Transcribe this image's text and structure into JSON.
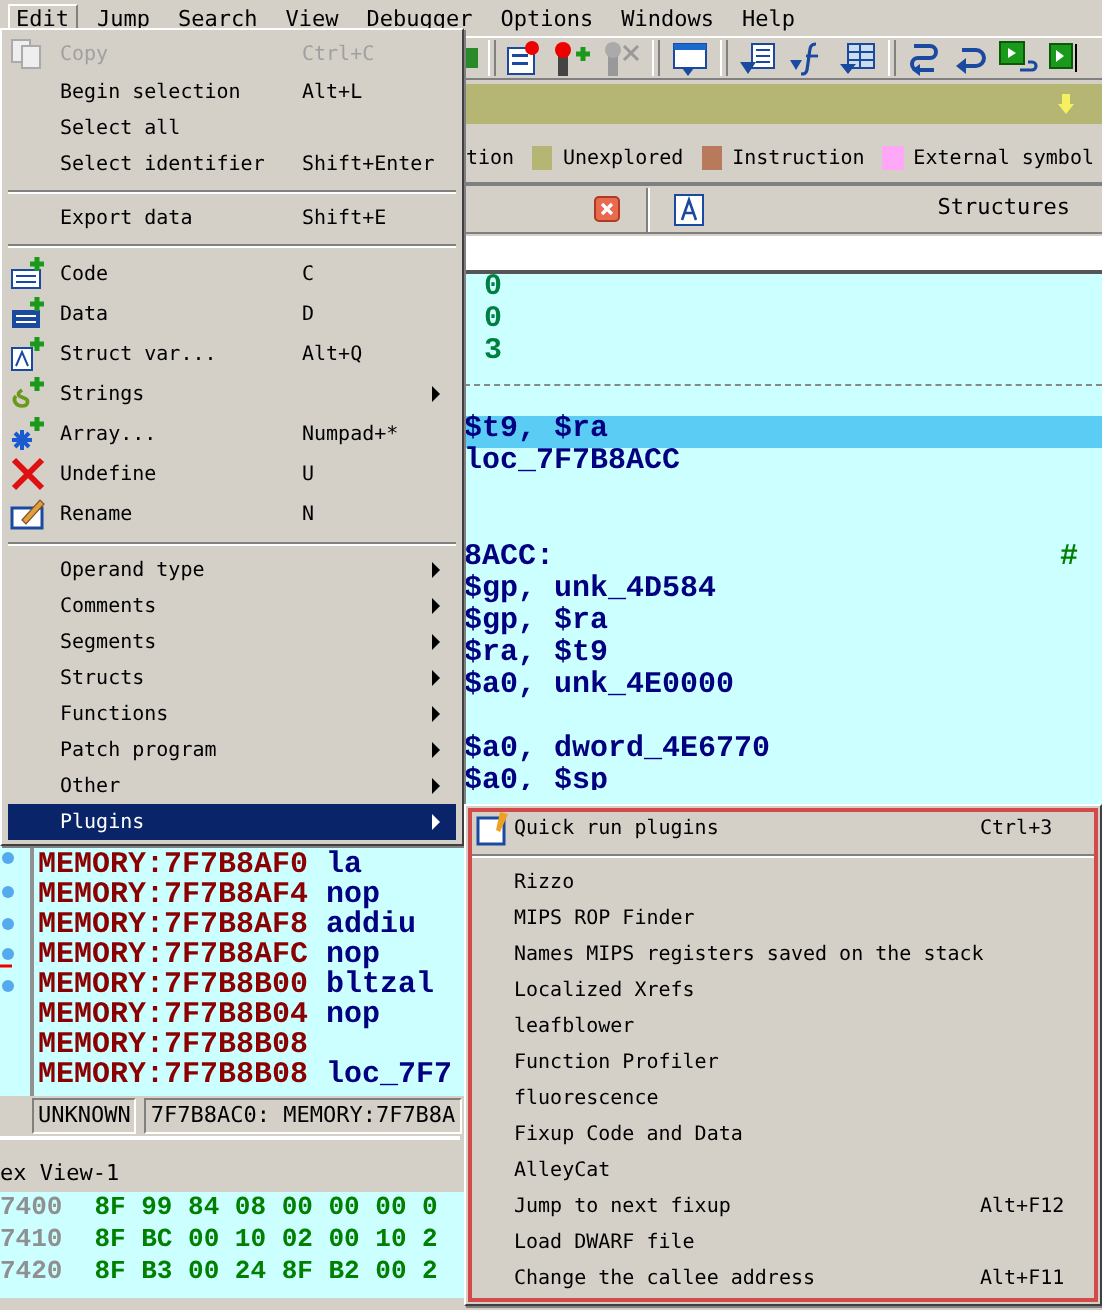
{
  "menubar": [
    {
      "label": "Edit",
      "selected": true
    },
    {
      "label": "Jump",
      "selected": false
    },
    {
      "label": "Search",
      "selected": false
    },
    {
      "label": "View",
      "selected": false
    },
    {
      "label": "Debugger",
      "selected": false
    },
    {
      "label": "Options",
      "selected": false
    },
    {
      "label": "Windows",
      "selected": false
    },
    {
      "label": "Help",
      "selected": false
    }
  ],
  "legend": [
    {
      "label": "tion"
    },
    {
      "label": "Unexplored",
      "color": "#b5b574"
    },
    {
      "label": "Instruction",
      "color": "#b87a5a"
    },
    {
      "label": "External symbol",
      "color": "#ffa8f8"
    }
  ],
  "tab_bar": {
    "title": "Structures"
  },
  "code_lines": [
    {
      "kind": "number",
      "text": "0",
      "selected": false
    },
    {
      "kind": "number",
      "text": "0",
      "selected": false
    },
    {
      "kind": "number",
      "text": "3",
      "selected": false
    },
    {
      "kind": "divider",
      "selected": false
    },
    {
      "kind": "code",
      "text": "$t9, $ra",
      "selected": true
    },
    {
      "kind": "code",
      "text": "loc_7F7B8ACC",
      "selected": false
    },
    {
      "kind": "blank",
      "selected": false
    },
    {
      "kind": "blank",
      "selected": false
    },
    {
      "kind": "code",
      "text": "8ACC:",
      "comment": "#",
      "selected": false
    },
    {
      "kind": "code",
      "text": "$gp, unk_4D584",
      "selected": false
    },
    {
      "kind": "code",
      "text": "$gp, $ra",
      "selected": false
    },
    {
      "kind": "code",
      "text": "$ra, $t9",
      "selected": false
    },
    {
      "kind": "code",
      "text": "$a0, unk_4E0000",
      "selected": false
    },
    {
      "kind": "blank",
      "selected": false
    },
    {
      "kind": "code",
      "text": "$a0, dword_4E6770",
      "selected": false
    },
    {
      "kind": "code",
      "text": "$a0, $sp",
      "selected": false
    }
  ],
  "memory_lines": [
    {
      "address": "MEMORY:7F7B8AF0",
      "operation": "la"
    },
    {
      "address": "MEMORY:7F7B8AF4",
      "operation": "nop"
    },
    {
      "address": "MEMORY:7F7B8AF8",
      "operation": "addiu"
    },
    {
      "address": "MEMORY:7F7B8AFC",
      "operation": "nop"
    },
    {
      "address": "MEMORY:7F7B8B00",
      "operation": "bltzal"
    },
    {
      "address": "MEMORY:7F7B8B04",
      "operation": "nop"
    },
    {
      "address": "MEMORY:7F7B8B08"
    },
    {
      "address": "MEMORY:7F7B8B08",
      "operation": "loc_7F7"
    }
  ],
  "status_bar": [
    "UNKNOWN",
    "7F7B8AC0: MEMORY:7F7B8A"
  ],
  "hex_view": {
    "title": "ex View-1",
    "rows": [
      {
        "address": "7400",
        "bytes": "8F 99 84 08 00 00 00 0"
      },
      {
        "address": "7410",
        "bytes": "8F BC 00 10 02 00 10 2"
      },
      {
        "address": "7420",
        "bytes": "8F B3 00 24 8F B2 00 2"
      }
    ]
  },
  "edit_menu": [
    {
      "kind": "item",
      "label": "Copy",
      "shortcut": "Ctrl+C",
      "disabled": true,
      "selected": false
    },
    {
      "kind": "item",
      "label": "Begin selection",
      "shortcut": "Alt+L",
      "disabled": false,
      "selected": false
    },
    {
      "kind": "item",
      "label": "Select all",
      "disabled": false,
      "selected": false
    },
    {
      "kind": "item",
      "label": "Select identifier",
      "shortcut": "Shift+Enter",
      "disabled": false,
      "selected": false
    },
    {
      "kind": "separator"
    },
    {
      "kind": "item",
      "label": "Export data",
      "shortcut": "Shift+E",
      "disabled": false,
      "selected": false
    },
    {
      "kind": "separator"
    },
    {
      "kind": "item",
      "label": "Code",
      "shortcut": "C",
      "disabled": false,
      "selected": false
    },
    {
      "kind": "item",
      "label": "Data",
      "shortcut": "D",
      "disabled": false,
      "selected": false
    },
    {
      "kind": "item",
      "label": "Struct var...",
      "shortcut": "Alt+Q",
      "disabled": false,
      "selected": false
    },
    {
      "kind": "submenu",
      "label": "Strings",
      "disabled": false,
      "selected": false
    },
    {
      "kind": "item",
      "label": "Array...",
      "shortcut": "Numpad+*",
      "disabled": false,
      "selected": false
    },
    {
      "kind": "item",
      "label": "Undefine",
      "shortcut": "U",
      "disabled": false,
      "selected": false
    },
    {
      "kind": "item",
      "label": "Rename",
      "shortcut": "N",
      "disabled": false,
      "selected": false
    },
    {
      "kind": "separator"
    },
    {
      "kind": "submenu",
      "label": "Operand type",
      "disabled": false,
      "selected": false
    },
    {
      "kind": "submenu",
      "label": "Comments",
      "disabled": false,
      "selected": false
    },
    {
      "kind": "submenu",
      "label": "Segments",
      "disabled": false,
      "selected": false
    },
    {
      "kind": "submenu",
      "label": "Structs",
      "disabled": false,
      "selected": false
    },
    {
      "kind": "submenu",
      "label": "Functions",
      "disabled": false,
      "selected": false
    },
    {
      "kind": "submenu",
      "label": "Patch program",
      "disabled": false,
      "selected": false
    },
    {
      "kind": "submenu",
      "label": "Other",
      "disabled": false,
      "selected": false
    },
    {
      "kind": "submenu",
      "label": "Plugins",
      "disabled": false,
      "selected": true
    }
  ],
  "plugins_menu": [
    {
      "kind": "item",
      "label": "Quick run plugins",
      "shortcut": "Ctrl+3"
    },
    {
      "kind": "separator"
    },
    {
      "kind": "item",
      "label": "Rizzo"
    },
    {
      "kind": "item",
      "label": "MIPS ROP Finder"
    },
    {
      "kind": "item",
      "label": "Names MIPS registers saved on the stack"
    },
    {
      "kind": "item",
      "label": "Localized Xrefs"
    },
    {
      "kind": "item",
      "label": "leafblower"
    },
    {
      "kind": "item",
      "label": "Function Profiler"
    },
    {
      "kind": "item",
      "label": "fluorescence"
    },
    {
      "kind": "item",
      "label": "Fixup Code and Data"
    },
    {
      "kind": "item",
      "label": "AlleyCat"
    },
    {
      "kind": "item",
      "label": "Jump to next fixup",
      "shortcut": "Alt+F12"
    },
    {
      "kind": "item",
      "label": "Load DWARF file"
    },
    {
      "kind": "item",
      "label": "Change the callee address",
      "shortcut": "Alt+F11"
    }
  ]
}
